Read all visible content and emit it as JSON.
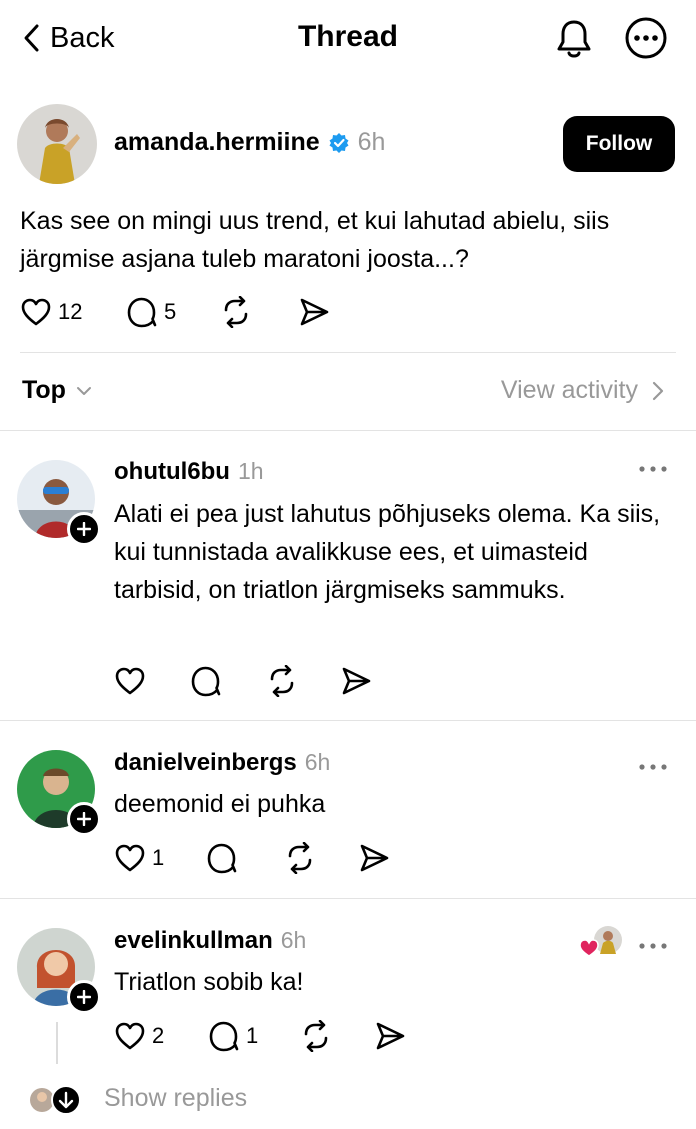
{
  "header": {
    "back_label": "Back",
    "title": "Thread"
  },
  "post": {
    "username": "amanda.hermiine",
    "verified": true,
    "time": "6h",
    "follow_label": "Follow",
    "text": "Kas see on mingi uus trend, et kui lahutad abielu, siis järgmise asjana tuleb maratoni joosta...?",
    "likes": "12",
    "replies": "5"
  },
  "sort": {
    "label": "Top",
    "view_activity": "View activity"
  },
  "replies": [
    {
      "username": "ohutul6bu",
      "time": "1h",
      "text": "Alati ei pea just lahutus põhjuseks olema. Ka siis, kui tunnistada avalikkuse ees, et uimasteid tarbisid, on triatlon järgmiseks sammuks.",
      "likes": "",
      "replies": ""
    },
    {
      "username": "danielveinbergs",
      "time": "6h",
      "text": "deemonid ei puhka",
      "likes": "1",
      "replies": ""
    },
    {
      "username": "evelinkullman",
      "time": "6h",
      "text": "Triatlon sobib ka!",
      "likes": "2",
      "replies": "1",
      "liked_by_author": true
    }
  ],
  "show_replies_label": "Show replies",
  "colors": {
    "verified": "#1d9bf0",
    "heart": "#e0245e",
    "muted": "#999999"
  }
}
